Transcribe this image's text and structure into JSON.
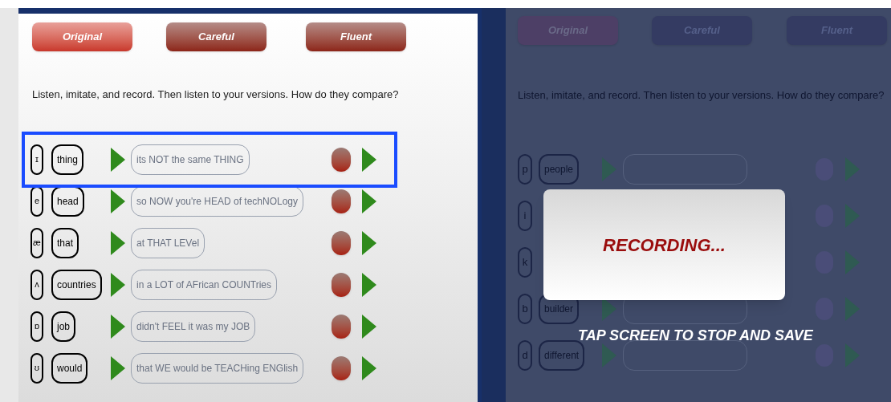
{
  "lesson": {
    "modes": [
      {
        "label": "Original",
        "selected": true
      },
      {
        "label": "Careful",
        "selected": false
      },
      {
        "label": "Fluent",
        "selected": false
      }
    ],
    "instruction": "Listen, imitate, and record. Then listen to your versions. How do they compare?",
    "rows": [
      {
        "symbol": "ɪ",
        "word": "thing",
        "sentence": "its NOT the same THING",
        "highlighted": true
      },
      {
        "symbol": "e",
        "word": "head",
        "sentence": "so NOW you're HEAD of techNOLogy",
        "highlighted": false
      },
      {
        "symbol": "æ",
        "word": "that",
        "sentence": "at THAT LEVel",
        "highlighted": false
      },
      {
        "symbol": "ʌ",
        "word": "countries",
        "sentence": "in a LOT of AFrican COUNTries",
        "highlighted": false
      },
      {
        "symbol": "ɒ",
        "word": "job",
        "sentence": "didn't FEEL it was my JOB",
        "highlighted": false
      },
      {
        "symbol": "ʊ",
        "word": "would",
        "sentence": "that WE would be TEACHing ENGlish",
        "highlighted": false
      }
    ]
  },
  "recording_screen": {
    "modes": [
      {
        "label": "Original",
        "selected": true
      },
      {
        "label": "Careful",
        "selected": false
      },
      {
        "label": "Fluent",
        "selected": false
      }
    ],
    "instruction": "Listen, imitate, and record. Then listen to your versions. How do they compare?",
    "rows": [
      {
        "symbol": "p",
        "word": "people"
      },
      {
        "symbol": "i"
      },
      {
        "symbol": "k"
      },
      {
        "symbol": "b",
        "word": "builder"
      },
      {
        "symbol": "d",
        "word": "different"
      }
    ],
    "dialog": {
      "title": "RECORDING...",
      "hint": "TAP SCREEN TO STOP AND SAVE"
    }
  }
}
